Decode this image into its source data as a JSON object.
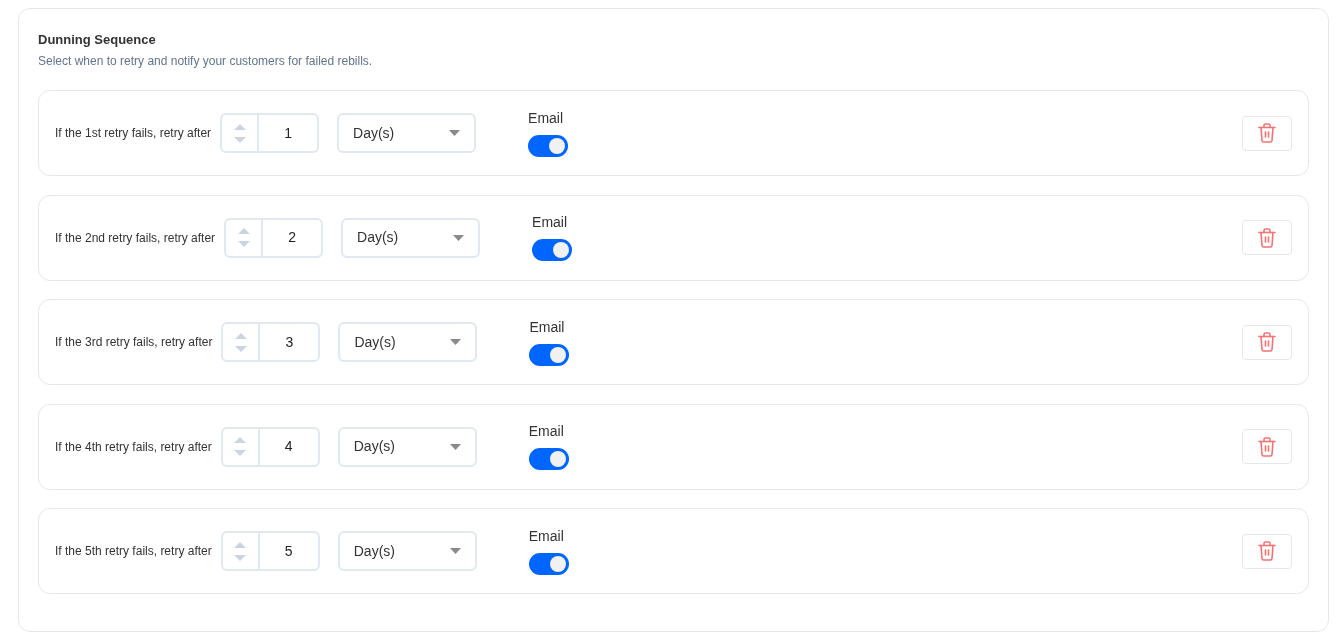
{
  "section": {
    "title": "Dunning Sequence",
    "subtitle": "Select when to retry and notify your customers for failed rebills."
  },
  "rows": [
    {
      "label": "If the 1st retry fails, retry after",
      "value": "1",
      "unit": "Day(s)",
      "toggle_label": "Email",
      "email_on": true
    },
    {
      "label": "If the 2nd retry fails, retry after",
      "value": "2",
      "unit": "Day(s)",
      "toggle_label": "Email",
      "email_on": true
    },
    {
      "label": "If the 3rd retry fails, retry after",
      "value": "3",
      "unit": "Day(s)",
      "toggle_label": "Email",
      "email_on": true
    },
    {
      "label": "If the 4th retry fails, retry after",
      "value": "4",
      "unit": "Day(s)",
      "toggle_label": "Email",
      "email_on": true
    },
    {
      "label": "If the 5th retry fails, retry after",
      "value": "5",
      "unit": "Day(s)",
      "toggle_label": "Email",
      "email_on": true
    }
  ]
}
